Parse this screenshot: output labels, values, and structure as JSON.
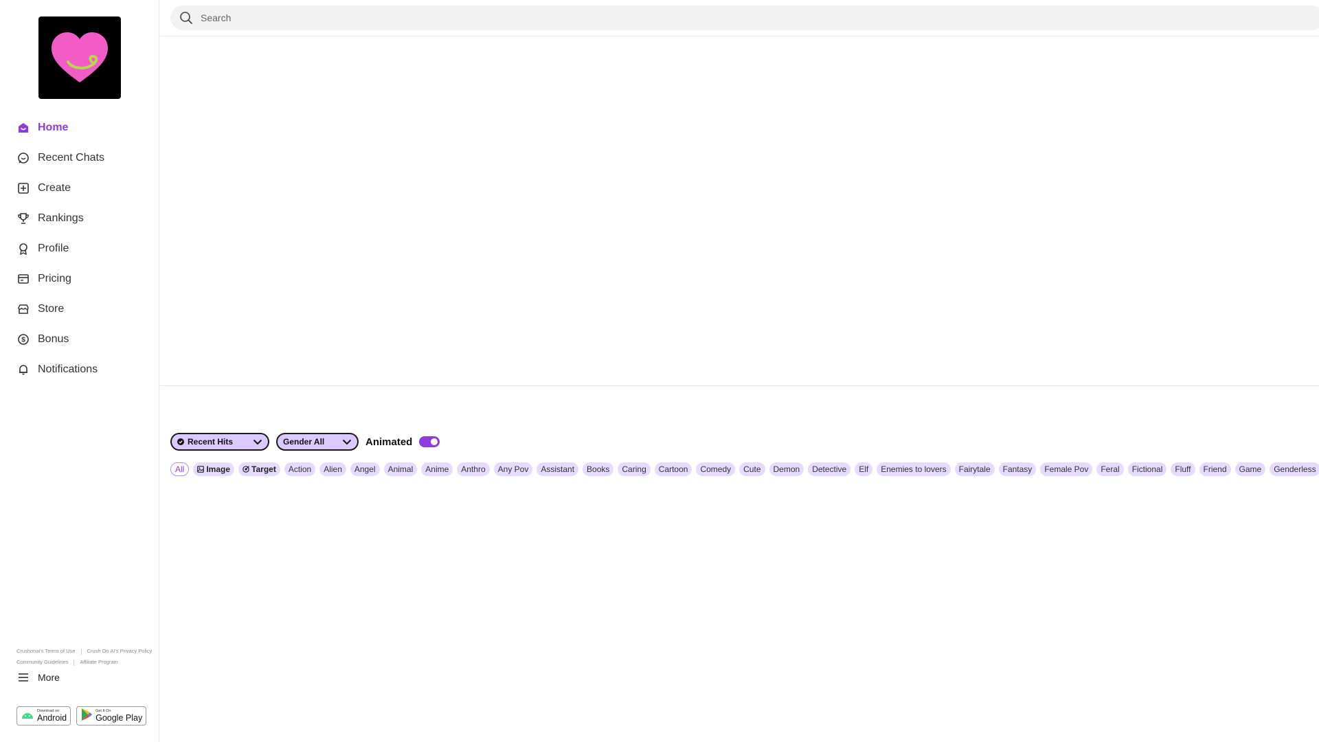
{
  "sidebar": {
    "items": [
      {
        "label": "Home",
        "icon": "home-icon",
        "active": true
      },
      {
        "label": "Recent Chats",
        "icon": "chat-icon"
      },
      {
        "label": "Create",
        "icon": "plus-square-icon"
      },
      {
        "label": "Rankings",
        "icon": "trophy-icon"
      },
      {
        "label": "Profile",
        "icon": "badge-icon"
      },
      {
        "label": "Pricing",
        "icon": "card-icon"
      },
      {
        "label": "Store",
        "icon": "store-icon"
      },
      {
        "label": "Bonus",
        "icon": "coin-icon"
      },
      {
        "label": "Notifications",
        "icon": "bell-icon"
      }
    ],
    "footer_links": [
      "Crushonai's Terms of Use",
      "Crush On AI's Privacy Policy",
      "Community Guidelines",
      "Affiliate Program"
    ],
    "more_label": "More",
    "badges": {
      "android_small": "Download on",
      "android_big": "Android",
      "google_small": "Get It On",
      "google_big": "Google Play"
    }
  },
  "search": {
    "placeholder": "Search"
  },
  "filters": {
    "sort_label": "Recent Hits",
    "gender_label": "Gender All",
    "animated_label": "Animated",
    "animated_on": true
  },
  "tags": [
    "All",
    "Image",
    "Target",
    "Action",
    "Alien",
    "Angel",
    "Animal",
    "Anime",
    "Anthro",
    "Any Pov",
    "Assistant",
    "Books",
    "Caring",
    "Cartoon",
    "Comedy",
    "Cute",
    "Demon",
    "Detective",
    "Elf",
    "Enemies to lovers",
    "Fairytale",
    "Fantasy",
    "Female Pov",
    "Feral",
    "Fictional",
    "Fluff",
    "Friend",
    "Game",
    "Genderless"
  ],
  "colors": {
    "accent": "#8e3be0",
    "chip": "#e6dbff",
    "dropdown": "#dcc9ff",
    "logo_heart": "#f25cc6",
    "logo_ribbon": "#b4d94a"
  }
}
